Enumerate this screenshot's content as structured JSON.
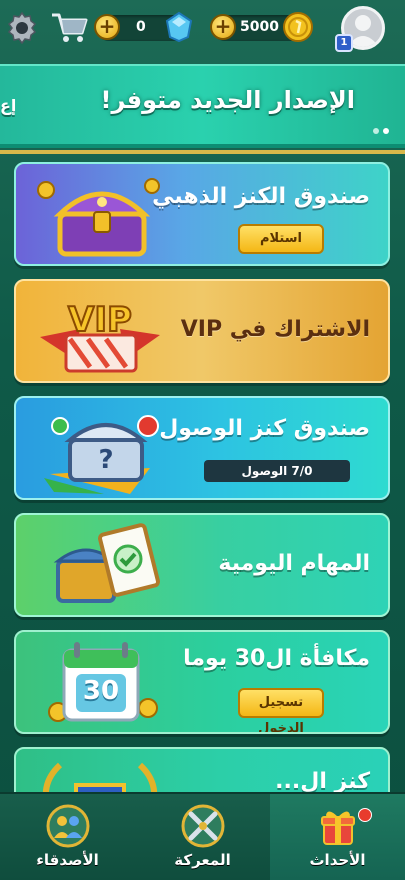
{
  "topbar": {
    "gems": "0",
    "coins": "5000",
    "level": "1"
  },
  "banner": {
    "title": "الإصدار الجديد متوفر!",
    "peek": "إع"
  },
  "cards": {
    "golden_chest": {
      "title": "صندوق الكنز الذهبي",
      "button": "استلام"
    },
    "vip": {
      "title": "الاشتراك في VIP"
    },
    "arrival_chest": {
      "title": "صندوق كنز الوصول",
      "progress": "7/0 الوصول"
    },
    "daily_tasks": {
      "title": "المهام اليومية"
    },
    "thirty_day": {
      "title": "مكافأة ال30 يوما",
      "button": "تسجيل الدخول",
      "calendar_number": "30"
    },
    "next_card": {
      "title": "كنز ال..."
    }
  },
  "nav": {
    "friends": "الأصدقاء",
    "battle": "المعركة",
    "events": "الأحداث"
  },
  "colors": {
    "background": "#0f5a48",
    "accent_gold": "#f4b715",
    "banner_teal": "#2ad1ae"
  }
}
